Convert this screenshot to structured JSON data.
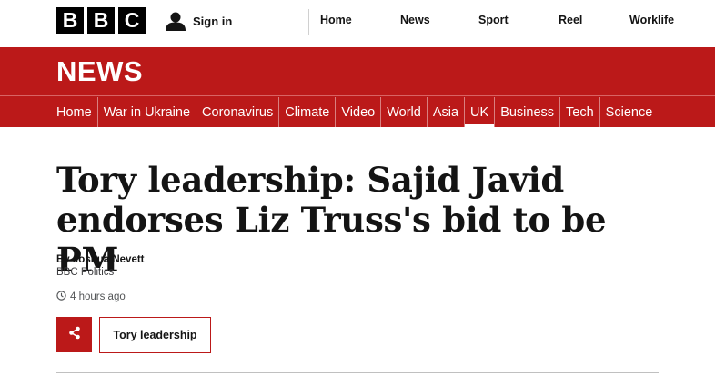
{
  "header": {
    "logo_letters": [
      "B",
      "B",
      "C"
    ],
    "signin_label": "Sign in",
    "nav": [
      "Home",
      "News",
      "Sport",
      "Reel",
      "Worklife"
    ]
  },
  "section": {
    "title": "NEWS",
    "nav": [
      "Home",
      "War in Ukraine",
      "Coronavirus",
      "Climate",
      "Video",
      "World",
      "Asia",
      "UK",
      "Business",
      "Tech",
      "Science"
    ],
    "active": "UK"
  },
  "article": {
    "headline": "Tory leadership: Sajid Javid endorses Liz Truss's bid to be PM",
    "author": "By Joshua Nevett",
    "role": "BBC Politics",
    "timestamp": "4 hours ago",
    "tag": "Tory leadership"
  },
  "icons": {
    "signin": "user-icon",
    "clock": "clock-icon",
    "share": "share-icon"
  },
  "colors": {
    "brand_red": "#bb1919",
    "text": "#141414"
  }
}
